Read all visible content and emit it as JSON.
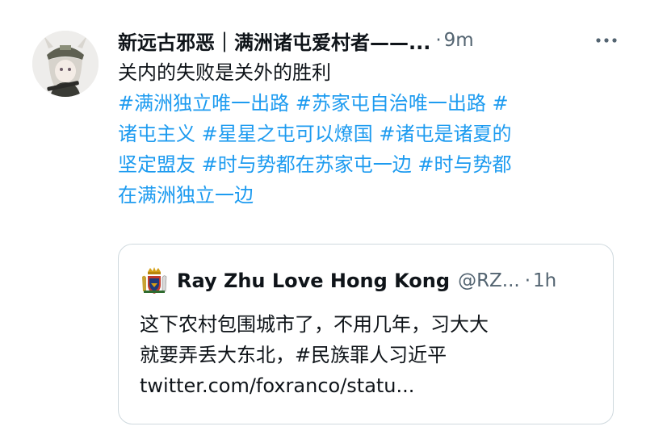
{
  "tweet": {
    "author_name": "新远古邪恶｜满洲诸屯爱村者——...",
    "separator": "·",
    "timestamp": "9m",
    "text": "关内的失败是关外的胜利",
    "hashtag_lines": [
      "#满洲独立唯一出路 #苏家屯自治唯一出路 #",
      "诸屯主义 #星星之屯可以燎国 #诸屯是诸夏的",
      "坚定盟友 #时与势都在苏家屯一边 #时与势都",
      "在满洲独立一边"
    ],
    "more_icon": "more-horizontal-icon"
  },
  "quote": {
    "author_name": "Ray Zhu Love Hong Kong",
    "handle": "@RZ...",
    "separator": "·",
    "timestamp": "1h",
    "avatar_icon": "coat-of-arms-icon",
    "text_lines": [
      "这下农村包围城市了，不用几年，习大大",
      "就要弄丢大东北，#民族罪人习近平",
      "twitter.com/foxranco/statu..."
    ]
  },
  "colors": {
    "text": "#0f1419",
    "muted": "#536471",
    "link": "#1d9bf0",
    "border": "#cfd9de"
  }
}
